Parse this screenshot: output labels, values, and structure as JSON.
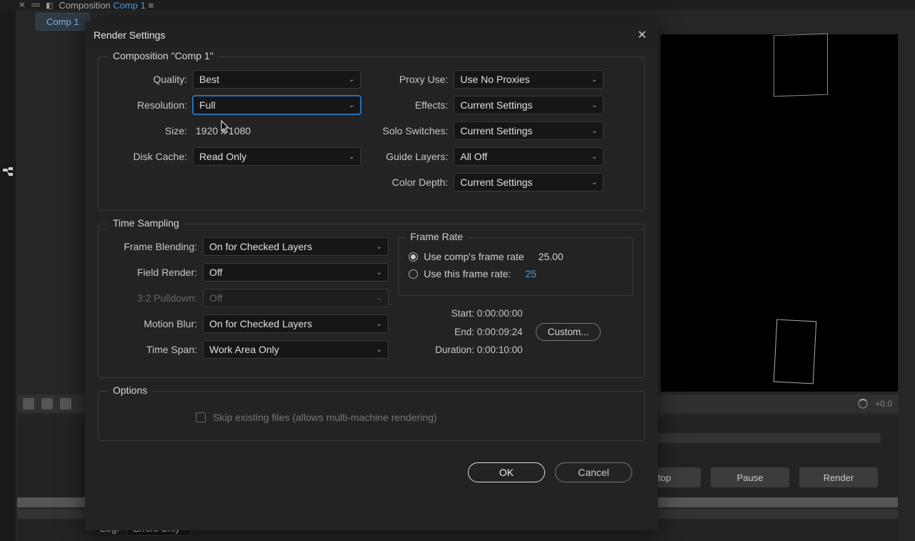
{
  "header": {
    "composition_prefix": "Composition",
    "composition_name": "Comp 1",
    "tab_name": "Comp 1"
  },
  "dialog": {
    "title": "Render Settings",
    "composition_label": "Composition \"Comp 1\"",
    "quality_label": "Quality:",
    "quality_value": "Best",
    "resolution_label": "Resolution:",
    "resolution_value": "Full",
    "size_label": "Size:",
    "size_value": "1920 x 1080",
    "disk_cache_label": "Disk Cache:",
    "disk_cache_value": "Read Only",
    "proxy_label": "Proxy Use:",
    "proxy_value": "Use No Proxies",
    "effects_label": "Effects:",
    "effects_value": "Current Settings",
    "solo_label": "Solo Switches:",
    "solo_value": "Current Settings",
    "guide_label": "Guide Layers:",
    "guide_value": "All Off",
    "depth_label": "Color Depth:",
    "depth_value": "Current Settings",
    "time_sampling_legend": "Time Sampling",
    "frame_blending_label": "Frame Blending:",
    "frame_blending_value": "On for Checked Layers",
    "field_render_label": "Field Render:",
    "field_render_value": "Off",
    "pulldown_label": "3:2 Pulldown:",
    "pulldown_value": "Off",
    "motion_blur_label": "Motion Blur:",
    "motion_blur_value": "On for Checked Layers",
    "time_span_label": "Time Span:",
    "time_span_value": "Work Area Only",
    "frame_rate_legend": "Frame Rate",
    "fr_comp_label": "Use comp's frame rate",
    "fr_comp_value": "25.00",
    "fr_this_label": "Use this frame rate:",
    "fr_this_value": "25",
    "start_label": "Start: 0:00:00:00",
    "end_label": "End: 0:00:09:24",
    "duration_label": "Duration: 0:00:10:00",
    "custom_btn": "Custom...",
    "options_legend": "Options",
    "skip_label": "Skip existing files (allows multi-machine rendering)",
    "ok": "OK",
    "cancel": "Cancel"
  },
  "render_queue": {
    "stop": "Stop",
    "pause": "Pause",
    "render": "Render",
    "log_label": "Log:",
    "log_value": "Errors Only"
  },
  "viewer": {
    "zoom_text": "+0.0"
  }
}
